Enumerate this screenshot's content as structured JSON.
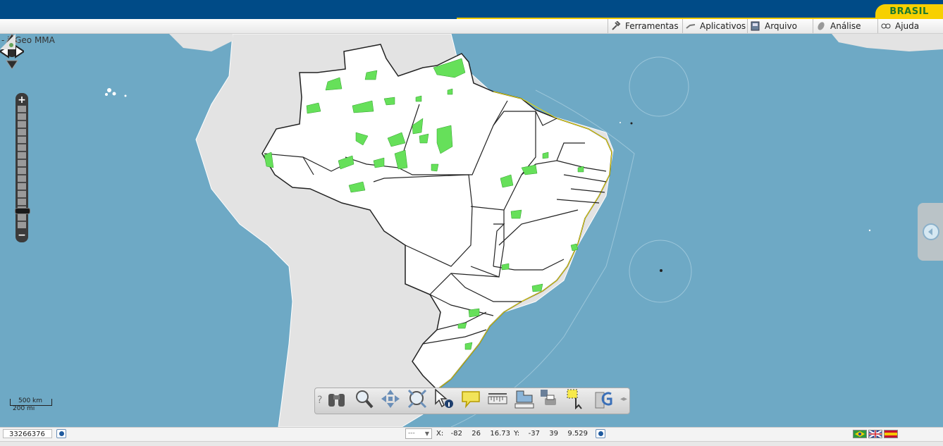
{
  "header": {
    "badge_text": "BRASIL"
  },
  "menu": [
    {
      "label": "Ferramentas",
      "icon": "tools-icon"
    },
    {
      "label": "Aplicativos",
      "icon": "apps-icon"
    },
    {
      "label": "Arquivo",
      "icon": "file-icon"
    },
    {
      "label": "Análise",
      "icon": "analysis-icon"
    },
    {
      "label": "Ajuda",
      "icon": "help-icon"
    }
  ],
  "map": {
    "title": "- i3Geo MMA",
    "scale_km": "500 km",
    "scale_mi": "200 mi",
    "zoom_in": "+",
    "zoom_out": "−",
    "colors": {
      "ocean": "#6ea9c5",
      "land": "#e3e3e3",
      "brazil": "#ffffff",
      "protected_areas": "#66e05a",
      "borders": "#1a1a1a"
    }
  },
  "toolbar": {
    "help_glyph": "?",
    "tools": [
      "binoculars-icon",
      "zoom-icon",
      "pan-icon",
      "zoom-extent-icon",
      "identify-icon",
      "tooltip-icon",
      "measure-distance-icon",
      "measure-area-icon",
      "print-icon",
      "select-icon",
      "google-icon"
    ]
  },
  "status": {
    "scale_value": "33266376",
    "coord_mode": "---",
    "x_label": "X:",
    "x_deg": "-82",
    "x_min": "26",
    "x_sec": "16.73",
    "y_label": "Y:",
    "y_deg": "-37",
    "y_min": "39",
    "y_sec": "9.529",
    "languages": [
      "pt",
      "en",
      "es"
    ]
  }
}
